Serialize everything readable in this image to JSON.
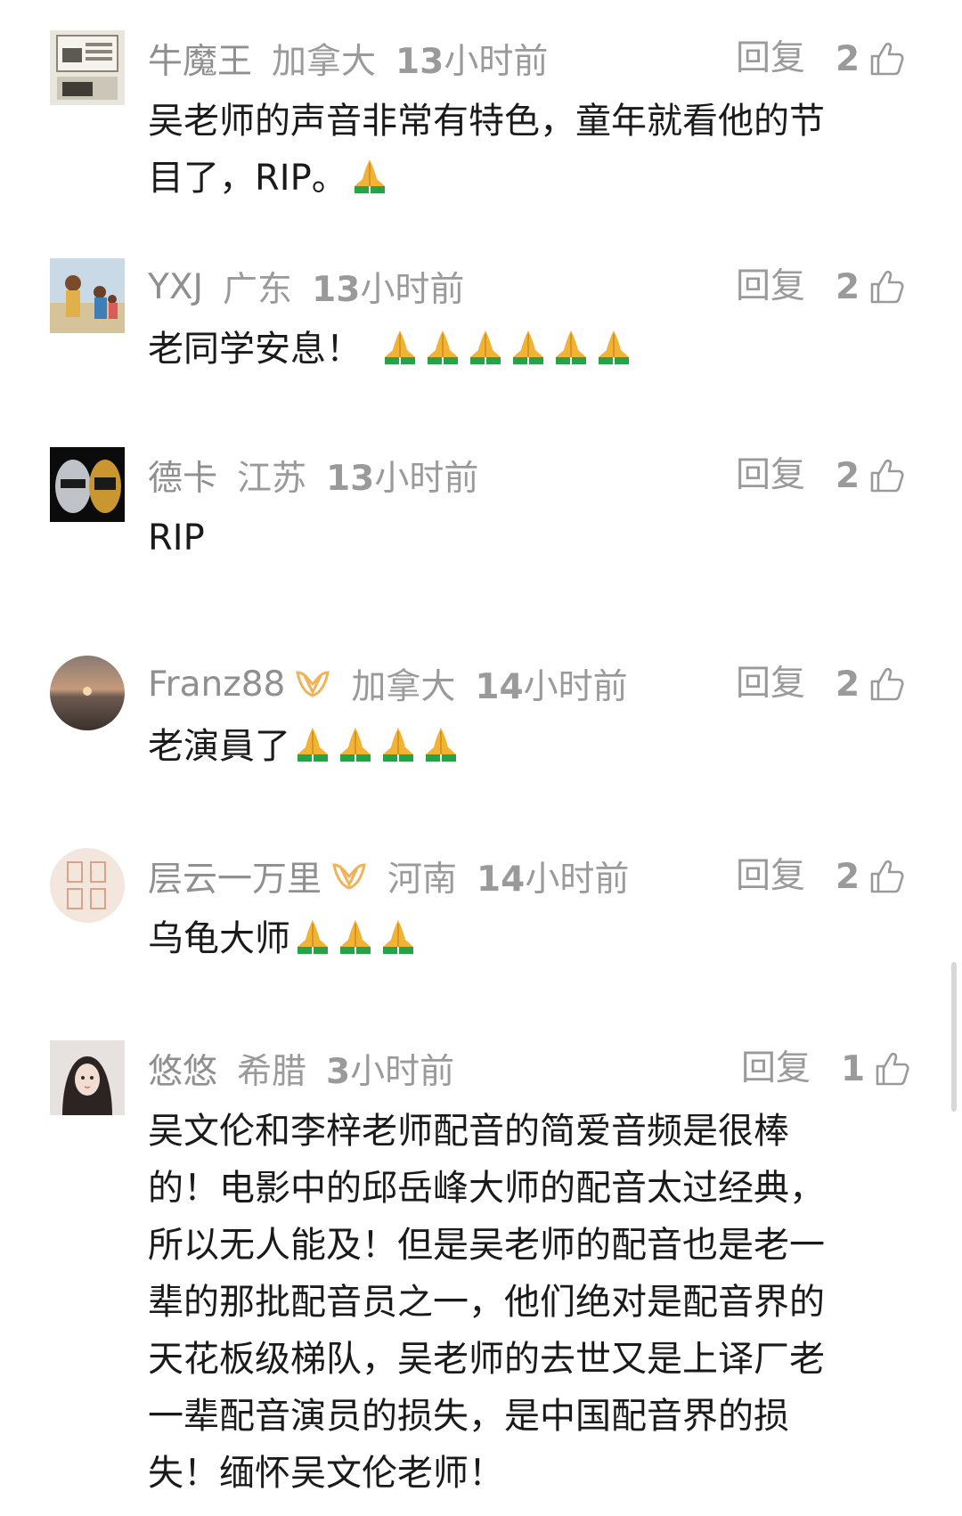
{
  "reply_label": "回复",
  "comments": [
    {
      "user": "牛魔王",
      "location": "加拿大",
      "time_num": "13",
      "time_unit": "小时前",
      "likes": "2",
      "lines": [
        "吴老师的声音非常有特色，童年就看他的节",
        "目了，RIP。"
      ],
      "emoji_count": 1
    },
    {
      "user": "YXJ",
      "location": "广东",
      "time_num": "13",
      "time_unit": "小时前",
      "likes": "2",
      "lines": [
        "老同学安息！"
      ],
      "emoji_count": 6
    },
    {
      "user": "德卡",
      "location": "江苏",
      "time_num": "13",
      "time_unit": "小时前",
      "likes": "2",
      "lines": [
        "RIP"
      ],
      "emoji_count": 0
    },
    {
      "user": "Franz88",
      "vip": true,
      "location": "加拿大",
      "time_num": "14",
      "time_unit": "小时前",
      "likes": "2",
      "lines": [
        "老演員了"
      ],
      "emoji_count": 4
    },
    {
      "user": "层云一万里",
      "vip": true,
      "location": "河南",
      "time_num": "14",
      "time_unit": "小时前",
      "likes": "2",
      "lines": [
        "乌龟大师"
      ],
      "emoji_count": 3
    },
    {
      "user": "悠悠",
      "location": "希腊",
      "time_num": "3",
      "time_unit": "小时前",
      "likes": "1",
      "lines": [
        "吴文伦和李梓老师配音的简爱音频是很棒",
        "的！电影中的邱岳峰大师的配音太过经典，",
        "所以无人能及！但是吴老师的配音也是老一",
        "辈的那批配音员之一，他们绝对是配音界的",
        "天花板级梯队，吴老师的去世又是上译厂老",
        "一辈配音演员的损失，是中国配音界的损",
        "失！缅怀吴文伦老师！"
      ],
      "emoji_count": 0
    }
  ],
  "emoji_icon": "folded-hands-emoji",
  "like_icon": "thumbs-up-icon",
  "vip_icon": "vip-badge-icon",
  "colors": {
    "text": "#1a1a1a",
    "meta": "#9a9a9a",
    "vip_badge": "#f0b35a",
    "pray": "#f2b233"
  }
}
